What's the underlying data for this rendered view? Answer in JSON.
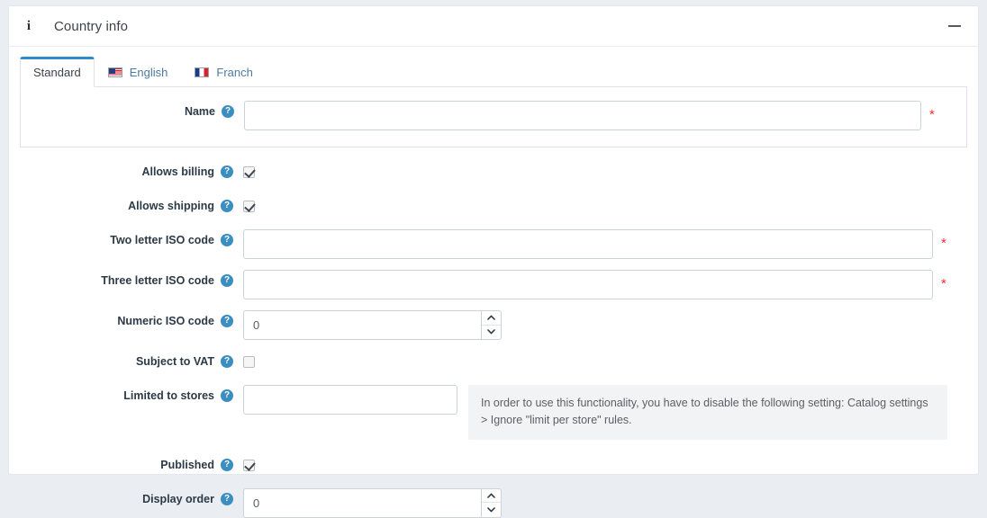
{
  "panel": {
    "info_icon": "info-icon",
    "title": "Country info",
    "collapse_icon": "minus-icon"
  },
  "tabs": [
    {
      "label": "Standard",
      "flag": null,
      "active": true
    },
    {
      "label": "English",
      "flag": "us-flag-icon",
      "active": false
    },
    {
      "label": "Franch",
      "flag": "fr-flag-icon",
      "active": false
    }
  ],
  "help_glyph": "?",
  "required_marker": "*",
  "fields": {
    "name": {
      "label": "Name",
      "value": "",
      "required": true
    },
    "allows_billing": {
      "label": "Allows billing",
      "checked": true
    },
    "allows_shipping": {
      "label": "Allows shipping",
      "checked": true
    },
    "two_letter_iso": {
      "label": "Two letter ISO code",
      "value": "",
      "required": true
    },
    "three_letter_iso": {
      "label": "Three letter ISO code",
      "value": "",
      "required": true
    },
    "numeric_iso": {
      "label": "Numeric ISO code",
      "value": "0"
    },
    "subject_to_vat": {
      "label": "Subject to VAT",
      "checked": false
    },
    "limited_to_stores": {
      "label": "Limited to stores",
      "value": ""
    },
    "published": {
      "label": "Published",
      "checked": true
    },
    "display_order": {
      "label": "Display order",
      "value": "0"
    }
  },
  "hint": {
    "text": "In order to use this functionality, you have to disable the following setting: Catalog settings > Ignore \"limit per store\" rules."
  },
  "colors": {
    "accent": "#2f8bc9",
    "help_blue": "#3a8ec0",
    "required_red": "#ff2c2c",
    "page_bg": "#eaedf2"
  }
}
